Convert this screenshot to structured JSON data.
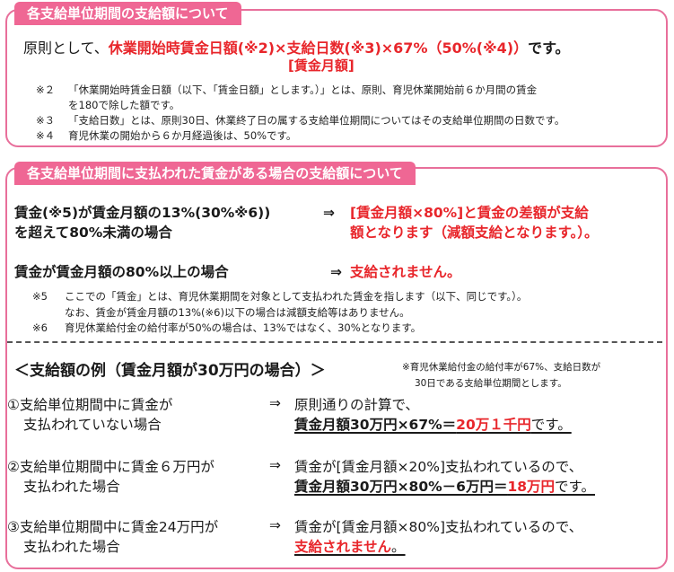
{
  "section1": {
    "title": "各支給単位期間の支給額について",
    "formula_prefix": "原則として、",
    "formula_red": "休業開始時賃金日額(※2)×支給日数(※3)×67%（50%(※4)）",
    "formula_suffix": "です。",
    "formula_sub": "[賃金月額]",
    "notes": [
      {
        "mark": "※２",
        "text": "「休業開始時賃金日額（以下、「賃金日額」とします。）」とは、原則、育児休業開始前６か月間の賃金"
      },
      {
        "mark": "",
        "text": "を180で除した額です。"
      },
      {
        "mark": "※３",
        "text": "「支給日数」とは、原則30日、休業終了日の属する支給単位期間についてはその支給単位期間の日数です。"
      },
      {
        "mark": "※４",
        "text": "育児休業の開始から６か月経過後は、50%です。"
      }
    ]
  },
  "section2": {
    "title": "各支給単位期間に支払われた賃金がある場合の支給額について",
    "case1_cond_line1": "賃金(※5)が賃金月額の13%(30%※6))",
    "case1_cond_line2": "を超えて80%未満の場合",
    "arrow": "⇒",
    "case1_res_line1": "[賃金月額×80%]と賃金の差額が支給",
    "case1_res_line2": "額となります（減額支給となります。）。",
    "case2_cond": "賃金が賃金月額の80%以上の場合",
    "case2_res": "支給されません。",
    "notes": [
      {
        "mark": "※5",
        "text": "ここでの「賃金」とは、育児休業期間を対象として支払われた賃金を指します（以下、同じです。）。"
      },
      {
        "mark": "",
        "text": "なお、賃金が賃金月額の13%(※6)以下の場合は減額支給等はありません。"
      },
      {
        "mark": "※6",
        "text": "育児休業給付金の給付率が50%の場合は、13%ではなく、30%となります。"
      }
    ]
  },
  "examples": {
    "title": "＜支給額の例（賃金月額が30万円の場合）＞",
    "note_line1": "※育児休業給付金の給付率が67%、支給日数が",
    "note_line2": "30日である支給単位期間とします。",
    "arrow": "⇒",
    "items": [
      {
        "cond_line1": "①支給単位期間中に賃金が",
        "cond_line2": "支払われていない場合",
        "res_line1": "原則通りの計算で、",
        "res_line2_bold": "賃金月額30万円×67%＝",
        "res_line2_red": "20万１千円",
        "res_line2_tail": "です。"
      },
      {
        "cond_line1": "②支給単位期間中に賃金６万円が",
        "cond_line2": "支払われた場合",
        "res_line1": "賃金が[賃金月額×20%]支払われているので、",
        "res_line2_bold": "賃金月額30万円×80%－6万円＝",
        "res_line2_red": "18万円",
        "res_line2_tail": "です。"
      },
      {
        "cond_line1": "③支給単位期間中に賃金24万円が",
        "cond_line2": "支払われた場合",
        "res_line1": "賃金が[賃金月額×80%]支払われているので、",
        "res_line2_red": "支給されません",
        "res_line2_tail": "。"
      }
    ]
  },
  "colors": {
    "accent_pink": "#ef6794",
    "border_pink": "#e86f9b",
    "red_text": "#e8262b"
  }
}
